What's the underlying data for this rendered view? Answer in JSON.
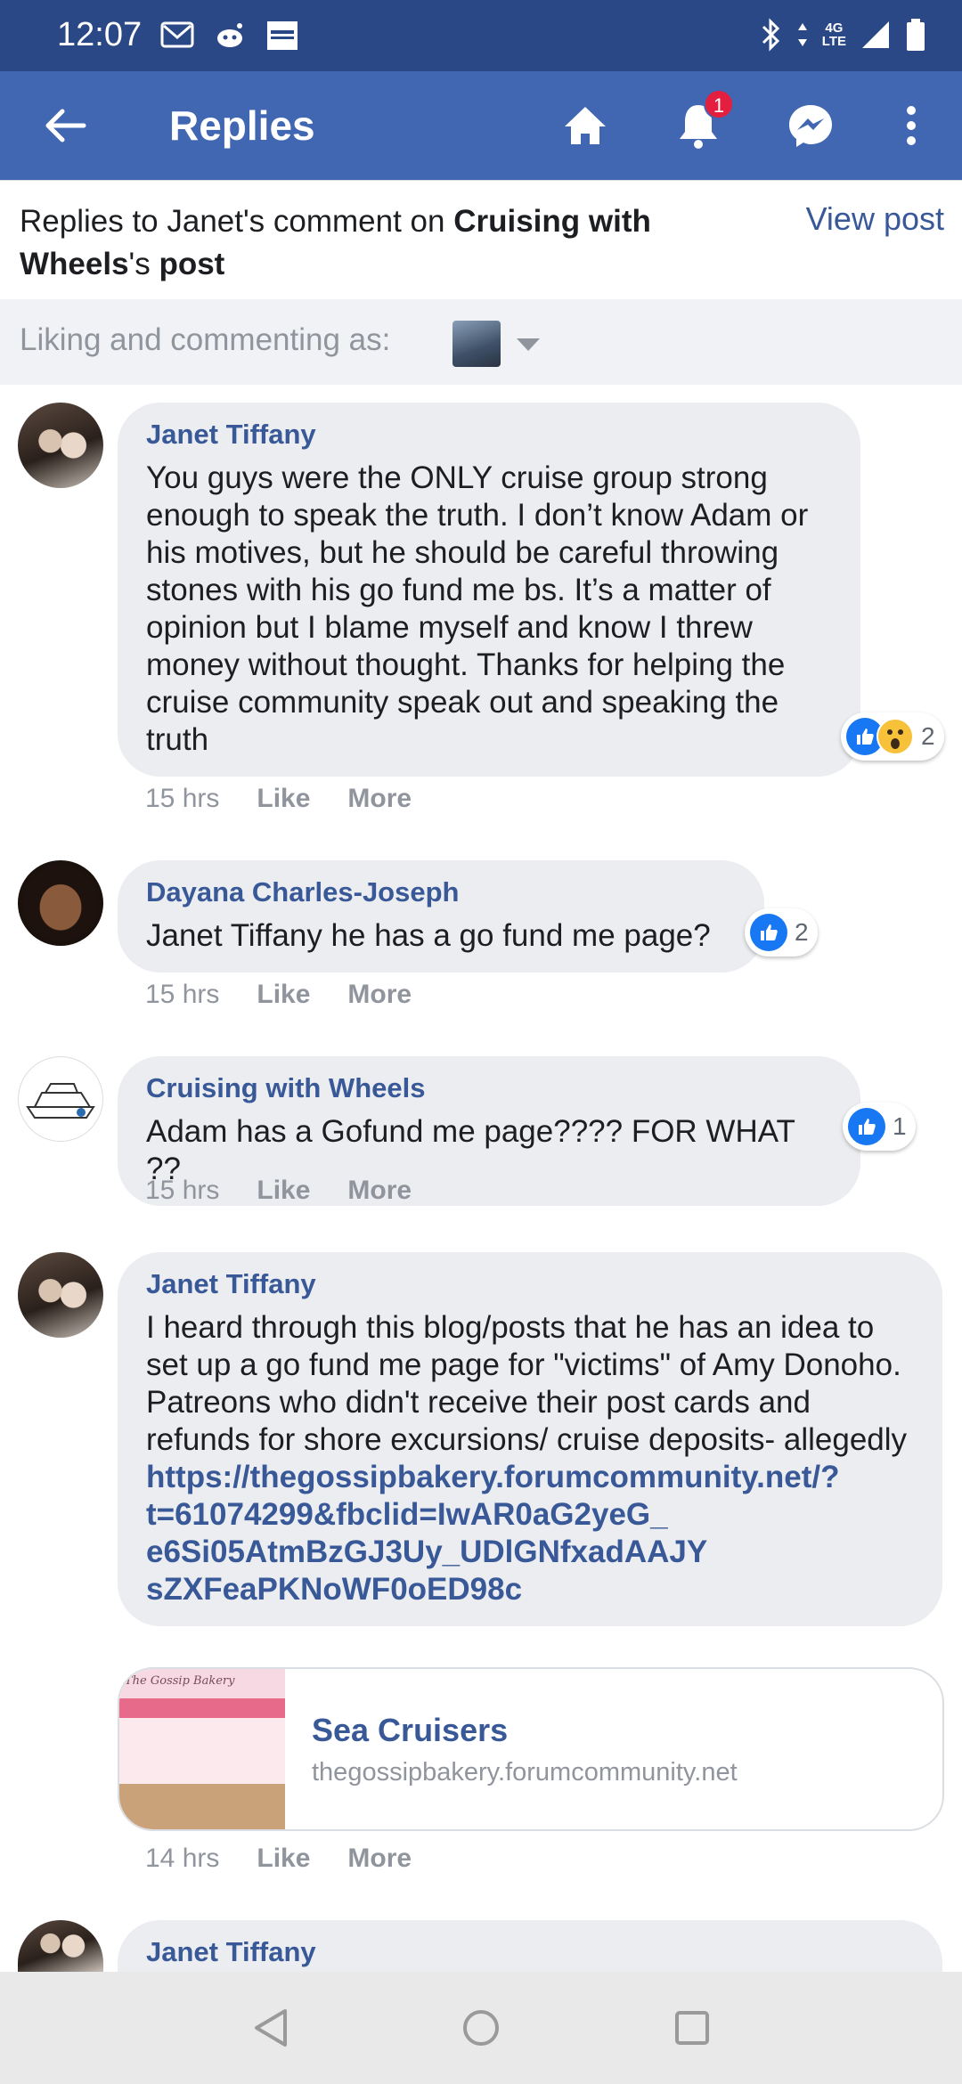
{
  "status_bar": {
    "time": "12:07",
    "network": "4G",
    "network_sub": "LTE"
  },
  "app_bar": {
    "title": "Replies",
    "notification_count": "1"
  },
  "header": {
    "prefix": "Replies to Janet's comment on ",
    "page_name": "Cruising with Wheels",
    "possessive": "'s ",
    "post_word": "post",
    "view_post": "View post"
  },
  "commenting_as": {
    "label": "Liking and commenting as:"
  },
  "comments": [
    {
      "author": "Janet Tiffany",
      "text": "You guys were the ONLY cruise group strong enough to speak the truth. I don’t know Adam or his motives, but he should be careful throwing stones with his go fund me bs. It’s a matter of opinion but I blame myself and know I threw money without thought. Thanks for helping the cruise community speak out and speaking the truth",
      "time": "15 hrs",
      "like": "Like",
      "more": "More",
      "reactions": "2"
    },
    {
      "author": "Dayana Charles-Joseph",
      "text": "Janet Tiffany he has a go fund me page?",
      "time": "15 hrs",
      "like": "Like",
      "more": "More",
      "reactions": "2"
    },
    {
      "author": "Cruising with Wheels",
      "text": "Adam has a Gofund me page???? FOR WHAT ??",
      "time": "15 hrs",
      "like": "Like",
      "more": "More",
      "reactions": "1"
    },
    {
      "author": "Janet Tiffany",
      "text": "I heard through this blog/posts that he has an idea to set up a go fund me page for \"victims\" of Amy Donoho. Patreons who didn't receive their post cards and refunds for shore excursions/ cruise deposits- allegedly",
      "link_lines": [
        "https://thegossipbakery.forumcommunity.net/?",
        "t=61074299&fbclid=IwAR0aG2yeG_",
        "e6Si05AtmBzGJ3Uy_UDlGNfxadAAJY",
        "sZXFeaPKNoWF0oED98c"
      ],
      "preview": {
        "title": "Sea Cruisers",
        "domain": "thegossipbakery.forumcommunity.net",
        "image_caption": "The Gossip Bakery"
      },
      "time": "14 hrs",
      "like": "Like",
      "more": "More"
    },
    {
      "author": "Janet Tiffany"
    }
  ],
  "colors": {
    "status_bar": "#2a4886",
    "app_bar": "#4267b2",
    "link": "#385898",
    "bubble": "#ebedf0",
    "like_blue": "#1877f2",
    "badge_red": "#e41e3f"
  }
}
